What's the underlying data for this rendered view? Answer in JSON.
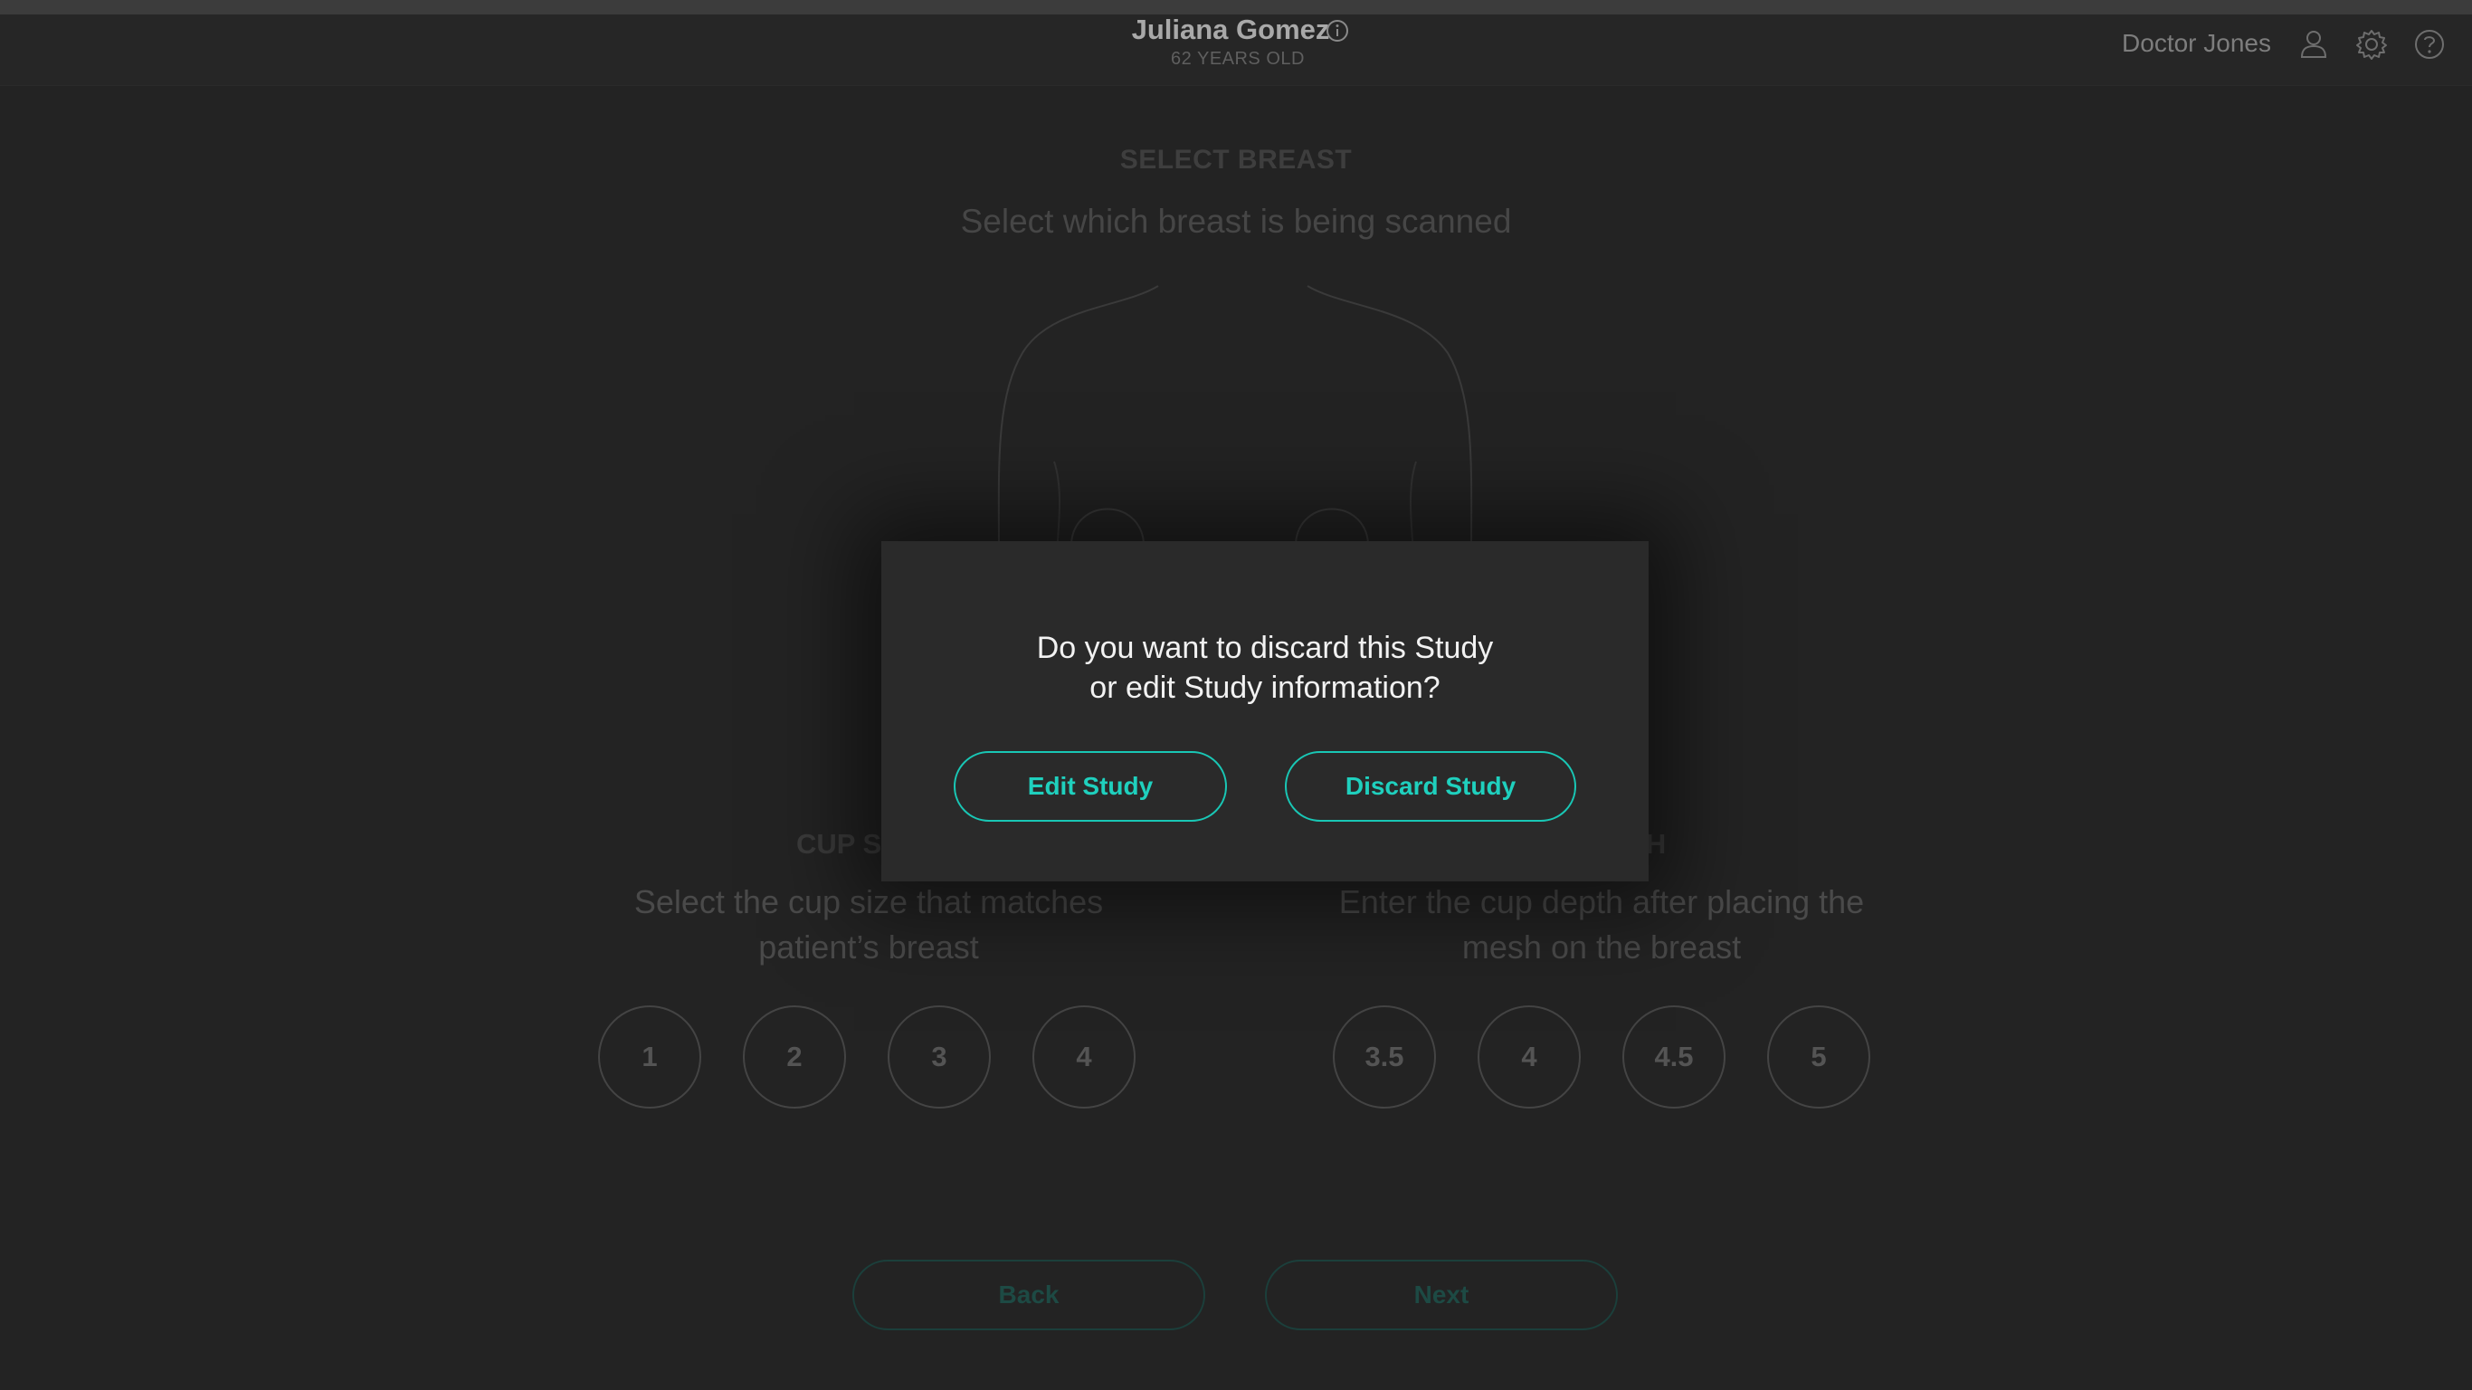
{
  "header": {
    "patient_name": "Juliana Gomez",
    "patient_age": "62 YEARS OLD",
    "doctor_name": "Doctor Jones",
    "icons": [
      "info-icon",
      "user-icon",
      "gear-icon",
      "help-icon"
    ]
  },
  "select_breast": {
    "title": "SELECT BREAST",
    "subtitle": "Select which breast is being scanned"
  },
  "cup_size": {
    "title": "CUP S",
    "description_line1": "Select the cup size that matches",
    "description_line2": "patient’s breast",
    "options": [
      "1",
      "2",
      "3",
      "4"
    ]
  },
  "cup_depth": {
    "title": "TH",
    "description_line1": "Enter the cup depth after placing the",
    "description_line2": "mesh on the breast",
    "options": [
      "3.5",
      "4",
      "4.5",
      "5"
    ]
  },
  "navigation": {
    "back_label": "Back",
    "next_label": "Next"
  },
  "modal": {
    "message_line1": "Do you want to discard this Study",
    "message_line2": "or edit Study information?",
    "edit_label": "Edit Study",
    "discard_label": "Discard Study"
  },
  "colors": {
    "background": "#232323",
    "accent": "#1fd0be",
    "modal_background": "#2a2a2a"
  }
}
